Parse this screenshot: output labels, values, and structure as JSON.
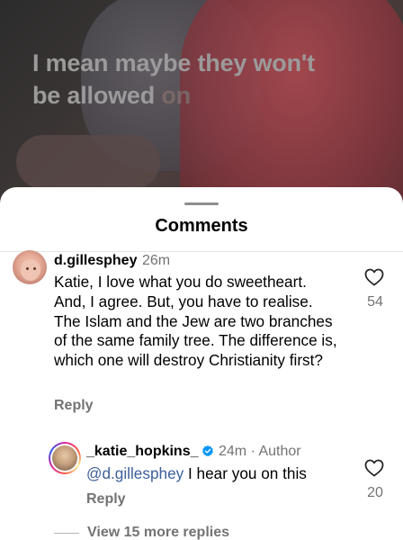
{
  "video": {
    "caption_line1": "I mean maybe they won't",
    "caption_line2a": "be allowed",
    "caption_line2b": " on"
  },
  "sheet": {
    "title": "Comments"
  },
  "comments": [
    {
      "username": "d.gillesphey",
      "time": "26m",
      "text": "Katie, I love what you do sweetheart. And, I agree. But, you have to realise. The Islam and the Jew are two branches of the same family tree. The difference is, which one will destroy Christianity first?",
      "reply_label": "Reply",
      "likes": "54",
      "heart_icon": "heart-outline-icon"
    }
  ],
  "replies": [
    {
      "username": "_katie_hopkins_",
      "verified": true,
      "time": "24m · Author",
      "mention": "@d.gillesphey",
      "text": " I hear you on this",
      "reply_label": "Reply",
      "likes": "20",
      "heart_icon": "heart-outline-icon"
    }
  ],
  "more_replies": "View 15 more replies",
  "colors": {
    "mention": "#3d5f9a",
    "secondary_text": "#737373",
    "verified": "#0095f6"
  }
}
